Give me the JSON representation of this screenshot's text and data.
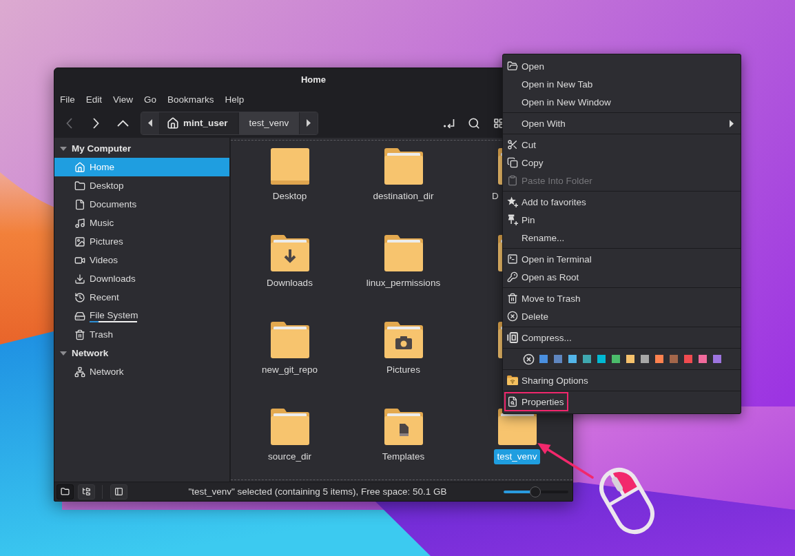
{
  "window": {
    "title": "Home"
  },
  "menu_bar": {
    "items": [
      "File",
      "Edit",
      "View",
      "Go",
      "Bookmarks",
      "Help"
    ]
  },
  "toolbar": {
    "nav_buttons": [
      {
        "disabled": true
      },
      {
        "disabled": false
      },
      {
        "disabled": false
      }
    ],
    "breadcrumbs": [
      {
        "label": "mint_user",
        "selected": true
      },
      {
        "label": "test_venv",
        "selected": false
      }
    ]
  },
  "sidebar": {
    "sections": [
      {
        "title": "My Computer",
        "expanded": true,
        "items": [
          {
            "label": "Home",
            "selected": true
          },
          {
            "label": "Desktop",
            "selected": false
          },
          {
            "label": "Documents",
            "selected": false
          },
          {
            "label": "Music",
            "selected": false
          },
          {
            "label": "Pictures",
            "selected": false
          },
          {
            "label": "Videos",
            "selected": false
          },
          {
            "label": "Downloads",
            "selected": false
          },
          {
            "label": "Recent",
            "selected": false
          },
          {
            "label": "File System",
            "selected": false,
            "level": 0.19
          },
          {
            "label": "Trash",
            "selected": false
          }
        ]
      },
      {
        "title": "Network",
        "expanded": true,
        "items": [
          {
            "label": "Network",
            "selected": false
          }
        ]
      }
    ]
  },
  "files": [
    {
      "kind": "desktop",
      "label": "Desktop",
      "selected": false,
      "clipped": false
    },
    {
      "kind": "folder",
      "label": "destination_dir",
      "selected": false,
      "clipped": false
    },
    {
      "kind": "folder",
      "label": "D",
      "selected": false,
      "clipped": true
    },
    {
      "kind": "downloads",
      "label": "Downloads",
      "selected": false,
      "clipped": false
    },
    {
      "kind": "folder",
      "label": "linux_permissions",
      "selected": false,
      "clipped": false
    },
    {
      "kind": "folder"
    },
    {
      "kind": "folder",
      "label": "new_git_repo",
      "selected": false,
      "clipped": false
    },
    {
      "kind": "pictures",
      "label": "Pictures",
      "selected": false,
      "clipped": false
    },
    {
      "kind": "folder"
    },
    {
      "kind": "folder",
      "label": "source_dir",
      "selected": false,
      "clipped": false
    },
    {
      "kind": "templates",
      "label": "Templates",
      "selected": false,
      "clipped": false
    },
    {
      "kind": "folder",
      "label": "test_venv",
      "selected": true,
      "clipped": false
    }
  ],
  "context_menu": {
    "sections": [
      {
        "items": [
          {
            "label": "Open",
            "disabled": false,
            "submenu": false,
            "outlined": false
          },
          {
            "label": "Open in New Tab",
            "disabled": false,
            "submenu": false,
            "outlined": false
          },
          {
            "label": "Open in New Window",
            "disabled": false,
            "submenu": false,
            "outlined": false
          }
        ]
      },
      {
        "items": [
          {
            "label": "Open With",
            "disabled": false,
            "submenu": true,
            "outlined": false
          }
        ]
      },
      {
        "items": [
          {
            "label": "Cut",
            "disabled": false,
            "submenu": false,
            "outlined": false
          },
          {
            "label": "Copy",
            "disabled": false,
            "submenu": false,
            "outlined": false
          },
          {
            "label": "Paste Into Folder",
            "disabled": true,
            "submenu": false,
            "outlined": false
          }
        ]
      },
      {
        "items": [
          {
            "label": "Add to favorites",
            "disabled": false,
            "submenu": false,
            "outlined": false
          },
          {
            "label": "Pin",
            "disabled": false,
            "submenu": false,
            "outlined": false
          },
          {
            "label": "Rename...",
            "disabled": false,
            "submenu": false,
            "outlined": false
          }
        ]
      },
      {
        "items": [
          {
            "label": "Open in Terminal",
            "disabled": false,
            "submenu": false,
            "outlined": false
          },
          {
            "label": "Open as Root",
            "disabled": false,
            "submenu": false,
            "outlined": false
          }
        ]
      },
      {
        "items": [
          {
            "label": "Move to Trash",
            "disabled": false,
            "submenu": false,
            "outlined": false
          },
          {
            "label": "Delete",
            "disabled": false,
            "submenu": false,
            "outlined": false
          }
        ]
      },
      {
        "items": [
          {
            "label": "Compress...",
            "disabled": false,
            "submenu": false,
            "outlined": false
          }
        ]
      },
      {
        "swatches": [
          {
            "color": "#4a8fdf"
          },
          {
            "color": "#5f86c0"
          },
          {
            "color": "#53b5e9"
          },
          {
            "color": "#3fa8b0"
          },
          {
            "color": "#00b9d3"
          },
          {
            "color": "#4bbc6b"
          },
          {
            "color": "#f6c26c"
          },
          {
            "color": "#a7a7a7"
          },
          {
            "color": "#fe824f"
          },
          {
            "color": "#a3664a"
          },
          {
            "color": "#f04b50"
          },
          {
            "color": "#f06a9c"
          },
          {
            "color": "#9d74df"
          }
        ]
      },
      {
        "items": [
          {
            "label": "Sharing Options",
            "disabled": false,
            "submenu": false,
            "outlined": false
          }
        ]
      },
      {
        "items": [
          {
            "label": "Properties",
            "disabled": false,
            "submenu": false,
            "outlined": true
          }
        ]
      }
    ]
  },
  "status_bar": {
    "view_buttons": [
      {
        "selected": true
      },
      {
        "selected": false
      }
    ],
    "text": "\"test_venv\" selected (containing 5 items), Free space: 50.1 GB",
    "zoom": {
      "level": 0.49
    }
  }
}
